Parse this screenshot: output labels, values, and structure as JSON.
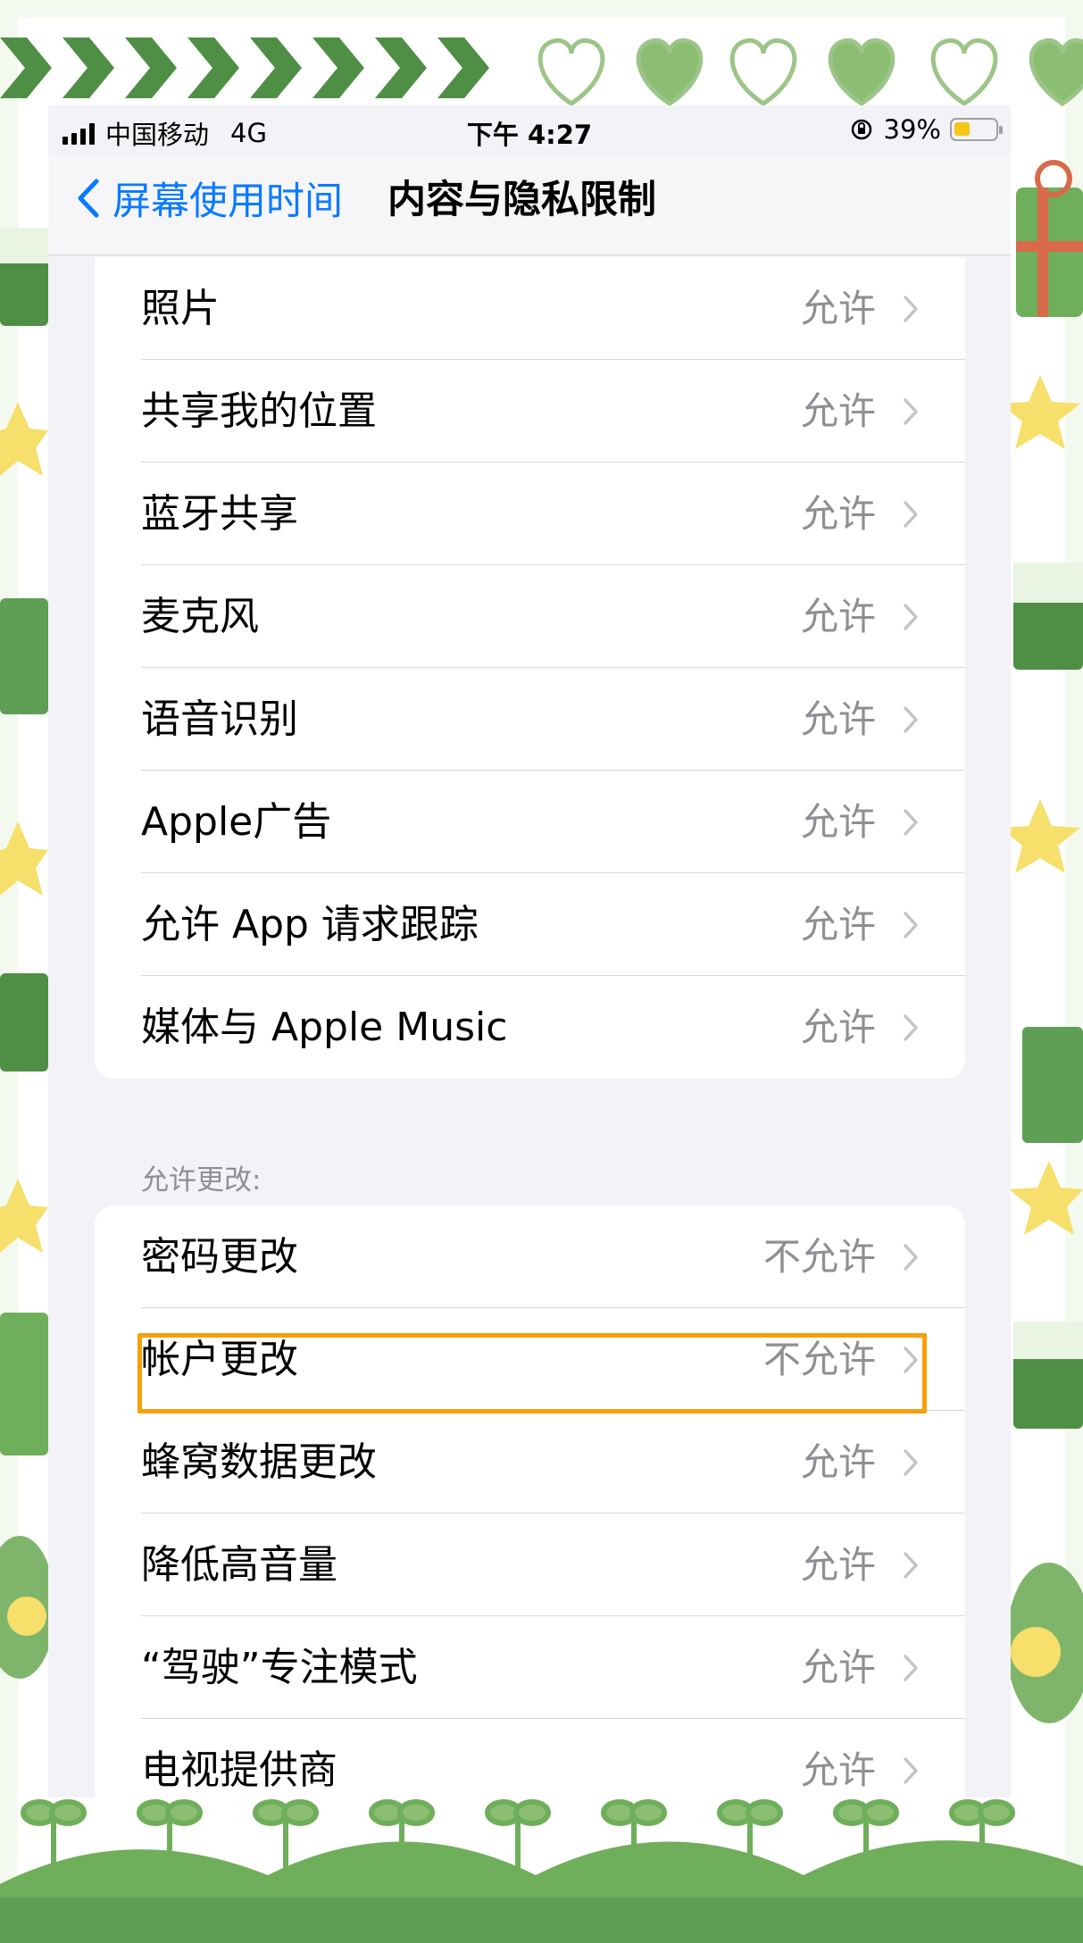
{
  "status_bar": {
    "carrier": "中国移动",
    "network": "4G",
    "time": "下午 4:27",
    "battery": "39%",
    "battery_level": 0.39
  },
  "nav": {
    "back_label": "屏幕使用时间",
    "title": "内容与隐私限制"
  },
  "group1": {
    "rows": [
      {
        "label": "照片",
        "value": "允许"
      },
      {
        "label": "共享我的位置",
        "value": "允许"
      },
      {
        "label": "蓝牙共享",
        "value": "允许"
      },
      {
        "label": "麦克风",
        "value": "允许"
      },
      {
        "label": "语音识别",
        "value": "允许"
      },
      {
        "label": "Apple广告",
        "value": "允许"
      },
      {
        "label": "允许 App 请求跟踪",
        "value": "允许"
      },
      {
        "label": "媒体与 Apple Music",
        "value": "允许"
      }
    ]
  },
  "section2": {
    "header": "允许更改:"
  },
  "group2": {
    "rows": [
      {
        "label": "密码更改",
        "value": "不允许"
      },
      {
        "label": "帐户更改",
        "value": "不允许"
      },
      {
        "label": "蜂窝数据更改",
        "value": "允许"
      },
      {
        "label": "降低高音量",
        "value": "允许"
      },
      {
        "label": "“驾驶”专注模式",
        "value": "允许"
      },
      {
        "label": "电视提供商",
        "value": "允许"
      }
    ]
  },
  "highlight": {
    "target": "帐户更改",
    "color": "#f5a00a"
  },
  "colors": {
    "accent": "#0a7aff",
    "frame_green": "#5f9e55",
    "light_green": "#9cc587",
    "background": "#f2f2f7"
  }
}
